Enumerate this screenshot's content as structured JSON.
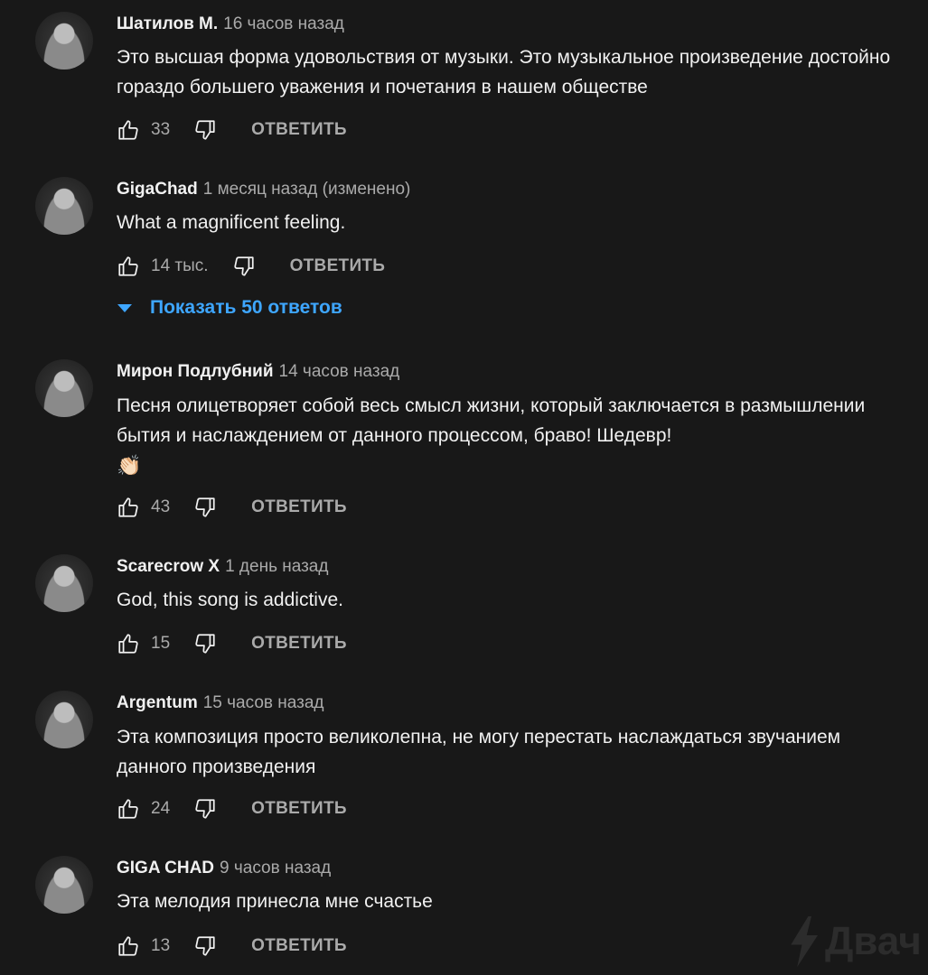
{
  "comments": [
    {
      "author": "Шатилов М.",
      "time": "16 часов назад",
      "text": "Это высшая форма удовольствия от музыки. Это музыкальное произведение достойно гораздо большего уважения и почетания в нашем обществе",
      "likes": "33",
      "reply_label": "ОТВЕТИТЬ"
    },
    {
      "author": "GigaChad",
      "time": "1 месяц назад (изменено)",
      "text": "What a magnificent feeling.",
      "likes": "14 тыс.",
      "reply_label": "ОТВЕТИТЬ",
      "show_replies_label": "Показать 50 ответов"
    },
    {
      "author": "Мирон Подлубний",
      "time": "14 часов назад",
      "text": "Песня олицетворяет собой весь смысл жизни, который заключается в размышлении бытия и наслаждением от данного процессом, браво! Шедевр!",
      "emoji": "👏🏻",
      "likes": "43",
      "reply_label": "ОТВЕТИТЬ"
    },
    {
      "author": "Scarecrow X",
      "time": "1 день назад",
      "text": "God, this song is addictive.",
      "likes": "15",
      "reply_label": "ОТВЕТИТЬ"
    },
    {
      "author": "Argentum",
      "time": "15 часов назад",
      "text": "Эта композиция просто великолепна, не могу перестать наслаждаться звучанием данного произведения",
      "likes": "24",
      "reply_label": "ОТВЕТИТЬ"
    },
    {
      "author": "GIGA CHAD",
      "time": "9 часов назад",
      "text": "Эта мелодия принесла мне счастье",
      "likes": "13",
      "reply_label": "ОТВЕТИТЬ"
    }
  ],
  "watermark": {
    "text": "Двач",
    "icon": "lightning-bolt-icon"
  },
  "colors": {
    "background": "#181818",
    "text": "#f1f1f1",
    "secondary": "#aaaaaa",
    "link": "#3ea6ff"
  }
}
